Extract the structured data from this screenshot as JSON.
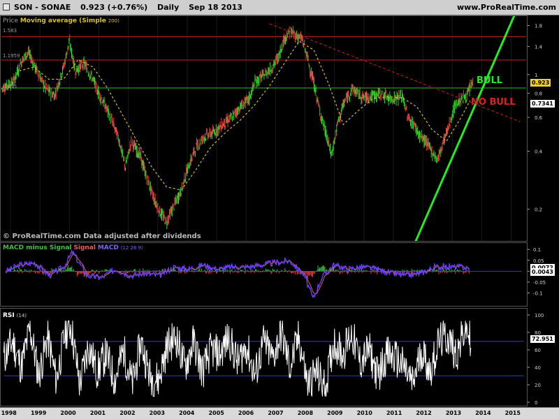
{
  "header": {
    "symbol": "SON - SONAE",
    "price": "0.923 (+0.76%)",
    "period": "Daily",
    "date": "Sep 18 2013",
    "brand": "www.ProRealTime.com"
  },
  "price_panel": {
    "legend_prefix": "Price",
    "legend_ma": "Moving average (Simple",
    "legend_ma_param": "200)",
    "copyright": "© ProRealTime.com  Data adjusted after dividends",
    "bull_label": "BULL",
    "nobull_label": "NO BULL",
    "last_price_tag": "0.923",
    "ma_tag": "0.7341",
    "resistance_labels": [
      "1.583",
      "1.1959",
      "0.855"
    ]
  },
  "macd_panel": {
    "legend_hist": "MACD minus Signal",
    "legend_signal": "Signal",
    "legend_macd": "MACD",
    "legend_params": "(12 26 9)",
    "tag_top": "0.0072",
    "tag_bottom": "0.0043"
  },
  "rsi_panel": {
    "legend": "RSI",
    "legend_params": "(14)",
    "tag": "72.951"
  },
  "colors": {
    "up": "#22dd22",
    "down": "#e04040",
    "ma": "#d8c020",
    "bull_line": "#22ee22",
    "nobull_line": "#cc2020",
    "macd": "#6a40ff",
    "signal": "#e06060",
    "hist": "#40c040",
    "rsi": "#ffffff",
    "guide": "#3a3ad0",
    "hline_red": "#d02020",
    "hline_green": "#30c030"
  },
  "chart_data": [
    {
      "type": "line",
      "name": "price",
      "scale": "log",
      "ylim": [
        0.15,
        1.9
      ],
      "yticks": [
        "1.8",
        "1.4",
        "1",
        "0.8",
        "0.6",
        "0.4",
        "0.2"
      ],
      "xticks": [
        "1998",
        "1999",
        "2000",
        "2001",
        "2002",
        "2003",
        "2004",
        "2005",
        "2006",
        "2007",
        "2008",
        "2009",
        "2010",
        "2011",
        "2012",
        "2013",
        "2014",
        "2015"
      ],
      "x": [
        1997.7,
        1998.1,
        1998.4,
        1998.6,
        1998.9,
        1999.2,
        1999.5,
        1999.8,
        2000.0,
        2000.2,
        2000.5,
        2000.8,
        2001.0,
        2001.3,
        2001.5,
        2001.7,
        2001.9,
        2002.1,
        2002.4,
        2002.6,
        2002.9,
        2003.1,
        2003.3,
        2003.5,
        2003.8,
        2004.0,
        2004.3,
        2004.6,
        2004.9,
        2005.2,
        2005.5,
        2005.8,
        2006.1,
        2006.3,
        2006.6,
        2006.9,
        2007.1,
        2007.3,
        2007.5,
        2007.7,
        2007.9,
        2008.1,
        2008.3,
        2008.5,
        2008.7,
        2008.9,
        2009.1,
        2009.3,
        2009.6,
        2009.8,
        2010.0,
        2010.3,
        2010.6,
        2010.9,
        2011.1,
        2011.3,
        2011.5,
        2011.7,
        2011.9,
        2012.1,
        2012.3,
        2012.5,
        2012.7,
        2012.9,
        2013.1,
        2013.3,
        2013.5,
        2013.7
      ],
      "values": [
        0.85,
        0.92,
        1.2,
        1.32,
        1.05,
        0.85,
        0.78,
        1.1,
        1.5,
        1.05,
        1.15,
        0.95,
        0.8,
        0.65,
        0.55,
        0.45,
        0.33,
        0.45,
        0.38,
        0.3,
        0.22,
        0.19,
        0.17,
        0.2,
        0.25,
        0.32,
        0.42,
        0.48,
        0.5,
        0.55,
        0.6,
        0.68,
        0.75,
        0.92,
        1.0,
        1.1,
        1.25,
        1.55,
        1.7,
        1.6,
        1.55,
        1.2,
        0.9,
        0.65,
        0.5,
        0.38,
        0.55,
        0.7,
        0.85,
        0.8,
        0.76,
        0.78,
        0.8,
        0.75,
        0.76,
        0.78,
        0.6,
        0.55,
        0.48,
        0.45,
        0.4,
        0.36,
        0.45,
        0.55,
        0.7,
        0.75,
        0.78,
        0.923
      ]
    },
    {
      "type": "line",
      "name": "Moving average (Simple 200)",
      "x": [
        1998.3,
        1998.8,
        1999.3,
        1999.8,
        2000.3,
        2000.8,
        2001.3,
        2001.8,
        2002.3,
        2002.8,
        2003.3,
        2003.8,
        2004.3,
        2004.8,
        2005.3,
        2005.8,
        2006.3,
        2006.8,
        2007.3,
        2007.8,
        2008.3,
        2008.8,
        2009.3,
        2009.8,
        2010.3,
        2010.8,
        2011.3,
        2011.8,
        2012.3,
        2012.8,
        2013.3,
        2013.6
      ],
      "values": [
        1.05,
        1.1,
        0.95,
        0.95,
        1.2,
        1.1,
        0.85,
        0.62,
        0.45,
        0.33,
        0.26,
        0.25,
        0.32,
        0.42,
        0.5,
        0.58,
        0.7,
        0.88,
        1.15,
        1.5,
        1.35,
        0.9,
        0.55,
        0.65,
        0.75,
        0.77,
        0.76,
        0.68,
        0.52,
        0.45,
        0.6,
        0.7341
      ]
    },
    {
      "type": "line",
      "name": "MACD",
      "ylim": [
        -0.15,
        0.12
      ],
      "yticks": [
        "0.1",
        "0.05",
        "0",
        "-0.05",
        "-0.1"
      ],
      "x": [
        1997.7,
        1998.2,
        1998.7,
        1999.2,
        1999.7,
        2000.0,
        2000.5,
        2001.0,
        2001.5,
        2002.0,
        2002.5,
        2003.0,
        2003.5,
        2004.0,
        2004.5,
        2005.0,
        2005.5,
        2006.0,
        2006.5,
        2007.0,
        2007.5,
        2008.0,
        2008.3,
        2008.6,
        2009.0,
        2009.5,
        2010.0,
        2010.5,
        2011.0,
        2011.5,
        2012.0,
        2012.5,
        2013.0,
        2013.5,
        2013.7
      ],
      "values": [
        0.0,
        0.03,
        0.04,
        -0.02,
        0.02,
        0.09,
        -0.02,
        -0.03,
        0.01,
        -0.02,
        -0.01,
        -0.02,
        0.02,
        0.01,
        0.03,
        0.01,
        0.02,
        0.02,
        0.03,
        0.04,
        0.05,
        -0.02,
        -0.13,
        -0.03,
        0.03,
        0.01,
        0.02,
        0.01,
        -0.01,
        -0.02,
        -0.01,
        0.02,
        0.02,
        0.02,
        0.0072
      ]
    },
    {
      "type": "line",
      "name": "RSI",
      "ylim": [
        0,
        100
      ],
      "yticks": [
        "100",
        "80",
        "60",
        "40",
        "20",
        "0"
      ],
      "guides": [
        70,
        30
      ],
      "x": [
        1997.7,
        1998.0,
        1998.3,
        1998.6,
        1998.9,
        1999.2,
        1999.5,
        1999.8,
        2000.0,
        2000.3,
        2000.6,
        2000.9,
        2001.2,
        2001.5,
        2001.8,
        2002.1,
        2002.4,
        2002.7,
        2003.0,
        2003.3,
        2003.6,
        2003.9,
        2004.2,
        2004.5,
        2004.8,
        2005.1,
        2005.4,
        2005.7,
        2006.0,
        2006.3,
        2006.6,
        2006.9,
        2007.2,
        2007.5,
        2007.8,
        2008.1,
        2008.4,
        2008.7,
        2009.0,
        2009.3,
        2009.6,
        2009.9,
        2010.2,
        2010.5,
        2010.8,
        2011.1,
        2011.4,
        2011.7,
        2012.0,
        2012.3,
        2012.6,
        2012.9,
        2013.2,
        2013.5,
        2013.7
      ],
      "values": [
        50,
        70,
        40,
        85,
        30,
        75,
        25,
        80,
        90,
        20,
        65,
        35,
        55,
        25,
        60,
        20,
        70,
        30,
        25,
        65,
        75,
        40,
        70,
        35,
        60,
        55,
        75,
        45,
        65,
        30,
        70,
        50,
        80,
        40,
        75,
        20,
        35,
        15,
        70,
        55,
        80,
        45,
        60,
        30,
        55,
        50,
        40,
        20,
        60,
        35,
        70,
        75,
        55,
        85,
        72.951
      ]
    }
  ]
}
